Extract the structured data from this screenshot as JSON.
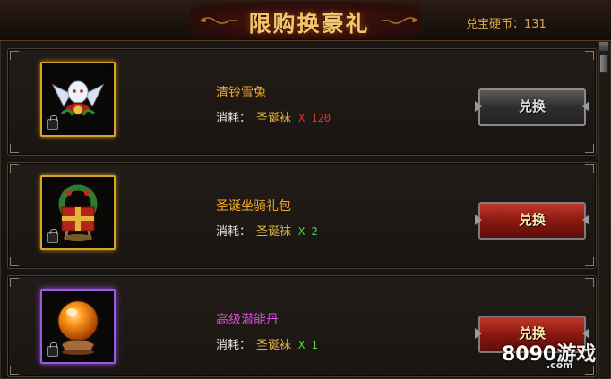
{
  "header": {
    "title": "限购换豪礼",
    "coins_text": "兑宝硬币：131"
  },
  "colors": {
    "gold_name": "#f0a830",
    "purple_name": "#d24fd8",
    "qty_red": "#e0322a",
    "qty_green": "#4fd84a",
    "cost_item": "#e2b243"
  },
  "items": [
    {
      "name": "清铃雪兔",
      "name_color": "#f0a830",
      "cost_label": "消耗：",
      "cost_item": "圣诞袜",
      "cost_qty": "X 120",
      "qty_color": "#e0322a",
      "button": "兑换",
      "button_state": "disabled",
      "frame": "gold",
      "icon": "snow-rabbit-icon"
    },
    {
      "name": "圣诞坐骑礼包",
      "name_color": "#f0a830",
      "cost_label": "消耗：",
      "cost_item": "圣诞袜",
      "cost_qty": "X 2",
      "qty_color": "#4fd84a",
      "button": "兑换",
      "button_state": "enabled",
      "frame": "gold",
      "icon": "christmas-mount-pack-icon"
    },
    {
      "name": "高级潜能丹",
      "name_color": "#d24fd8",
      "cost_label": "消耗：",
      "cost_item": "圣诞袜",
      "cost_qty": "X 1",
      "qty_color": "#4fd84a",
      "button": "兑换",
      "button_state": "enabled",
      "frame": "purple",
      "icon": "orange-orb-icon"
    }
  ],
  "watermark": {
    "brand": "8090",
    "text": "游戏",
    "domain": ".com"
  }
}
